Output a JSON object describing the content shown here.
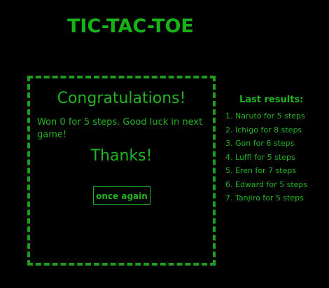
{
  "header": {
    "title": "TIC-TAC-TOE"
  },
  "result_panel": {
    "heading": "Congratulations!",
    "message": "Won 0 for 5 steps. Good luck in next game!",
    "thanks": "Thanks!",
    "again_button": "once again"
  },
  "last_results": {
    "title": "Last results:",
    "items": [
      "1. Naruto for 5 steps",
      "2. Ichigo for 8 steps",
      "3. Gon for 6 steps",
      "4. Luffi for 5 steps",
      "5. Eren for 7 steps",
      "6. Edward for 5 steps",
      "7. Tanjiro for 5 steps"
    ]
  },
  "colors": {
    "background": "#000000",
    "accent": "#22b322",
    "border": "#1d9e1d"
  }
}
